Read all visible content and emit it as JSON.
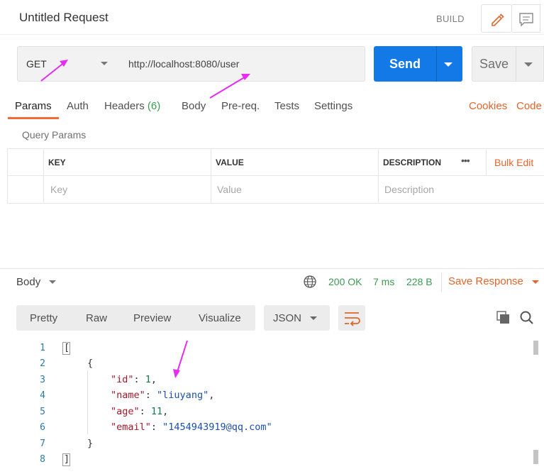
{
  "header": {
    "title": "Untitled Request",
    "build_label": "BUILD"
  },
  "request": {
    "method": "GET",
    "url": "http://localhost:8080/user",
    "send_label": "Send",
    "save_label": "Save"
  },
  "tabs": [
    {
      "label": "Params"
    },
    {
      "label": "Auth"
    },
    {
      "label": "Headers",
      "count": "(6)"
    },
    {
      "label": "Body"
    },
    {
      "label": "Pre-req."
    },
    {
      "label": "Tests"
    },
    {
      "label": "Settings"
    }
  ],
  "links": {
    "cookies": "Cookies",
    "code": "Code"
  },
  "params": {
    "section_title": "Query Params",
    "columns": [
      "KEY",
      "VALUE",
      "DESCRIPTION"
    ],
    "more": "•••",
    "bulk_edit": "Bulk Edit",
    "placeholders": {
      "key": "Key",
      "value": "Value",
      "description": "Description"
    }
  },
  "response": {
    "body_label": "Body",
    "status": "200 OK",
    "time": "7 ms",
    "size": "228 B",
    "save_response": "Save Response",
    "view_modes": [
      "Pretty",
      "Raw",
      "Preview",
      "Visualize"
    ],
    "format": "JSON"
  },
  "code_lines": {
    "n1": "1",
    "n2": "2",
    "n3": "3",
    "n4": "4",
    "n5": "5",
    "n6": "6",
    "n7": "7",
    "n8": "8",
    "l1": "[",
    "l2": "{",
    "l3k": "\"id\"",
    "l3v": "1",
    "l4k": "\"name\"",
    "l4v": "\"liuyang\"",
    "l5k": "\"age\"",
    "l5v": "11",
    "l6k": "\"email\"",
    "l6v": "\"1454943919@qq.com\"",
    "l7": "}",
    "l8": "]"
  },
  "colors": {
    "accent_orange": "#f26b3a",
    "send_blue": "#1279e6",
    "status_green": "#3c9a52",
    "annotation_arrow": "#e52cf0"
  },
  "icons": [
    "pencil-icon",
    "comment-icon",
    "chevron-down-icon",
    "globe-icon",
    "wrap-lines-icon",
    "copy-icon",
    "search-icon"
  ]
}
